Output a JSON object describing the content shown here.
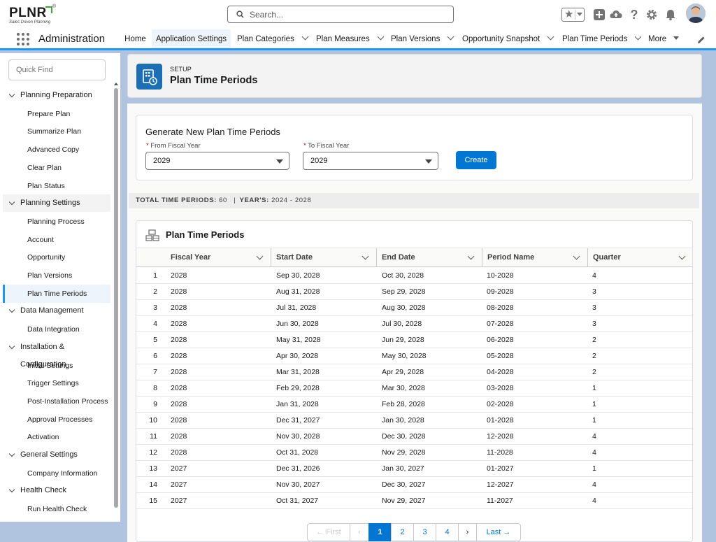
{
  "brand": {
    "name": "PLNR",
    "tagline": "Sales Driven Planning",
    "reg": "®"
  },
  "search": {
    "placeholder": "Search..."
  },
  "app": {
    "name": "Administration"
  },
  "nav": {
    "tabs": [
      {
        "label": "Home"
      },
      {
        "label": "Application Settings"
      },
      {
        "label": "Plan Categories"
      },
      {
        "label": "Plan Measures"
      },
      {
        "label": "Plan Versions"
      },
      {
        "label": "Opportunity Snapshot"
      },
      {
        "label": "Plan Time Periods"
      },
      {
        "label": "More"
      }
    ]
  },
  "sidebar": {
    "quick_find_placeholder": "Quick Find",
    "groups": [
      {
        "label": "Planning Preparation",
        "items": [
          "Prepare Plan",
          "Summarize Plan",
          "Advanced Copy",
          "Clear Plan",
          "Plan Status"
        ]
      },
      {
        "label": "Planning Settings",
        "items": [
          "Planning Process",
          "Account",
          "Opportunity",
          "Plan Versions",
          "Plan Time Periods"
        ]
      },
      {
        "label": "Data Management",
        "items": [
          "Data Integration"
        ]
      },
      {
        "label": "Installation & Configuration",
        "items": [
          "Initial Settings",
          "Trigger Settings",
          "Post-Installation Process",
          "Approval Processes",
          "Activation"
        ]
      },
      {
        "label": "General Settings",
        "items": [
          "Company Information"
        ]
      },
      {
        "label": "Health Check",
        "items": [
          "Run Health Check"
        ]
      }
    ]
  },
  "page": {
    "kicker": "SETUP",
    "title": "Plan Time Periods"
  },
  "generate": {
    "title": "Generate New Plan Time Periods",
    "required_mark": "*",
    "from_label": "From Fiscal Year",
    "from_value": "2029",
    "to_label": "To Fiscal Year",
    "to_value": "2029",
    "create_label": "Create"
  },
  "summary": {
    "total_label": "TOTAL TIME PERIODS:",
    "total_value": "60",
    "sep": "|",
    "years_label": "YEAR'S:",
    "years_value": "2024 - 2028"
  },
  "table": {
    "title": "Plan Time Periods",
    "columns": [
      "Fiscal Year",
      "Start Date",
      "End Date",
      "Period Name",
      "Quarter"
    ],
    "rows": [
      {
        "n": "1",
        "fy": "2028",
        "start": "Sep 30, 2028",
        "end": "Oct 30, 2028",
        "period": "10-2028",
        "q": "4"
      },
      {
        "n": "2",
        "fy": "2028",
        "start": "Aug 31, 2028",
        "end": "Sep 29, 2028",
        "period": "09-2028",
        "q": "3"
      },
      {
        "n": "3",
        "fy": "2028",
        "start": "Jul 31, 2028",
        "end": "Aug 30, 2028",
        "period": "08-2028",
        "q": "3"
      },
      {
        "n": "4",
        "fy": "2028",
        "start": "Jun 30, 2028",
        "end": "Jul 30, 2028",
        "period": "07-2028",
        "q": "3"
      },
      {
        "n": "5",
        "fy": "2028",
        "start": "May 31, 2028",
        "end": "Jun 29, 2028",
        "period": "06-2028",
        "q": "2"
      },
      {
        "n": "6",
        "fy": "2028",
        "start": "Apr 30, 2028",
        "end": "May 30, 2028",
        "period": "05-2028",
        "q": "2"
      },
      {
        "n": "7",
        "fy": "2028",
        "start": "Mar 31, 2028",
        "end": "Apr 29, 2028",
        "period": "04-2028",
        "q": "2"
      },
      {
        "n": "8",
        "fy": "2028",
        "start": "Feb 29, 2028",
        "end": "Mar 30, 2028",
        "period": "03-2028",
        "q": "1"
      },
      {
        "n": "9",
        "fy": "2028",
        "start": "Jan 31, 2028",
        "end": "Feb 28, 2028",
        "period": "02-2028",
        "q": "1"
      },
      {
        "n": "10",
        "fy": "2028",
        "start": "Dec 31, 2027",
        "end": "Jan 30, 2028",
        "period": "01-2028",
        "q": "1"
      },
      {
        "n": "11",
        "fy": "2028",
        "start": "Nov 30, 2028",
        "end": "Dec 30, 2028",
        "period": "12-2028",
        "q": "4"
      },
      {
        "n": "12",
        "fy": "2028",
        "start": "Oct 31, 2028",
        "end": "Nov 29, 2028",
        "period": "11-2028",
        "q": "4"
      },
      {
        "n": "13",
        "fy": "2027",
        "start": "Dec 31, 2026",
        "end": "Jan 30, 2027",
        "period": "01-2027",
        "q": "1"
      },
      {
        "n": "14",
        "fy": "2027",
        "start": "Nov 30, 2027",
        "end": "Dec 30, 2027",
        "period": "12-2027",
        "q": "4"
      },
      {
        "n": "15",
        "fy": "2027",
        "start": "Oct 31, 2027",
        "end": "Nov 29, 2027",
        "period": "11-2027",
        "q": "4"
      }
    ]
  },
  "pagination": {
    "first": "First",
    "last": "Last",
    "pages": [
      "1",
      "2",
      "3",
      "4"
    ],
    "current": "1"
  },
  "icons": {
    "search": "search-icon",
    "favorites": "star-icon",
    "add": "plus-icon",
    "trailhead": "cloud-icon",
    "help": "question-icon",
    "settings": "gear-icon",
    "notifications": "bell-icon",
    "edit_nav": "pencil-icon"
  },
  "colors": {
    "brand_blue": "#0176d3",
    "nav_accent": "#1b96ff",
    "logo_green": "#3aa935",
    "setup_icon": "#1b6fb5"
  }
}
